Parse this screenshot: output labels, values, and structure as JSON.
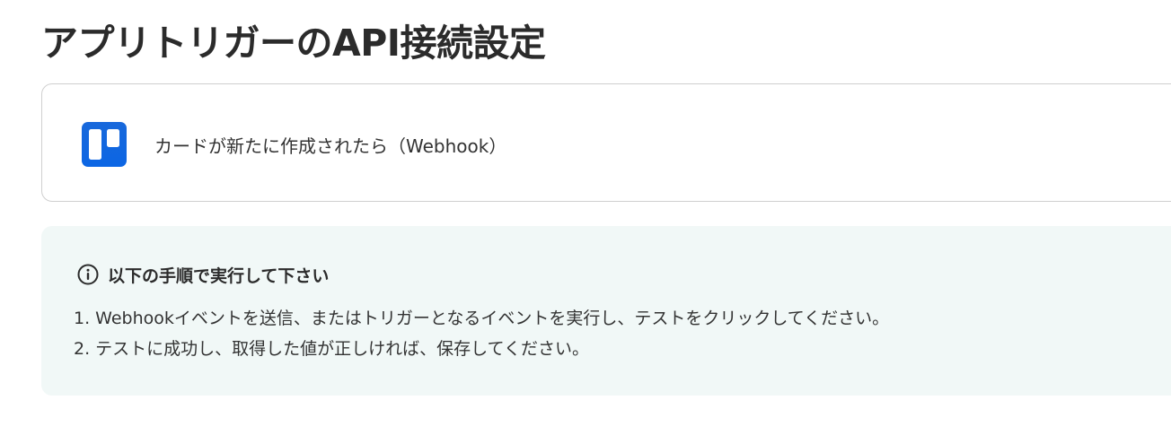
{
  "page": {
    "title": "アプリトリガーのAPI接続設定"
  },
  "trigger": {
    "app_icon": "trello-icon",
    "label": "カードが新たに作成されたら（Webhook）"
  },
  "instructions": {
    "icon": "info-icon",
    "title": "以下の手順で実行して下さい",
    "steps": [
      "1. Webhookイベントを送信、またはトリガーとなるイベントを実行し、テストをクリックしてください。",
      "2. テストに成功し、取得した値が正しければ、保存してください。"
    ]
  },
  "colors": {
    "trello_blue": "#0c66e4",
    "panel_background": "#f1f8f7",
    "text": "#333333"
  }
}
